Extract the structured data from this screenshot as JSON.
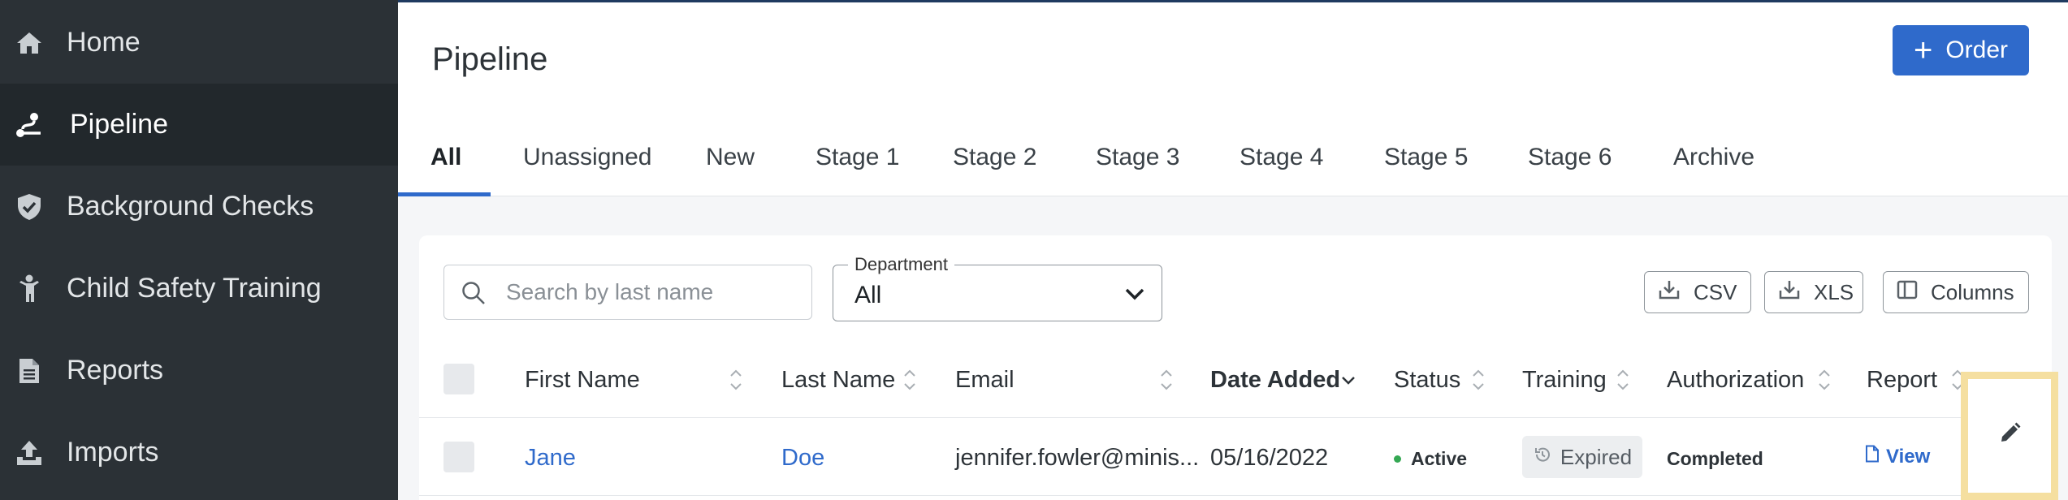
{
  "sidebar": {
    "items": [
      {
        "label": "Home",
        "icon": "home-icon",
        "active": false
      },
      {
        "label": "Pipeline",
        "icon": "pipeline-icon",
        "active": true
      },
      {
        "label": "Background Checks",
        "icon": "shield-icon",
        "active": false
      },
      {
        "label": "Child Safety Training",
        "icon": "child-icon",
        "active": false
      },
      {
        "label": "Reports",
        "icon": "document-icon",
        "active": false
      },
      {
        "label": "Imports",
        "icon": "upload-icon",
        "active": false
      }
    ]
  },
  "header": {
    "title": "Pipeline",
    "order_label": "Order",
    "tabs": [
      "All",
      "Unassigned",
      "New",
      "Stage 1",
      "Stage 2",
      "Stage 3",
      "Stage 4",
      "Stage 5",
      "Stage 6",
      "Archive"
    ],
    "active_tab": "All"
  },
  "toolbar": {
    "search_placeholder": "Search by last name",
    "department_label": "Department",
    "department_value": "All",
    "csv_label": "CSV",
    "xls_label": "XLS",
    "columns_label": "Columns"
  },
  "table": {
    "columns": [
      "First Name",
      "Last Name",
      "Email",
      "Date Added",
      "Status",
      "Training",
      "Authorization",
      "Report"
    ],
    "sorted_column": "Date Added",
    "rows": [
      {
        "first_name": "Jane",
        "last_name": "Doe",
        "email": "jennifer.fowler@minis...",
        "date_added": "05/16/2022",
        "status": "Active",
        "training": "Expired",
        "authorization": "Completed",
        "report": "View"
      }
    ]
  },
  "colors": {
    "sidebar_bg": "#2b3136",
    "sidebar_active_bg": "#22282c",
    "accent": "#2f6acb",
    "status_active": "#34a853",
    "highlight": "#f5dfa0"
  }
}
